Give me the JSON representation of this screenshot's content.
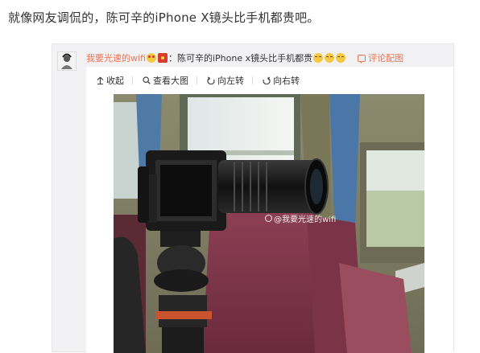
{
  "article": {
    "text": "就像网友调侃的，陈可辛的iPhone X镜头比手机都贵吧。"
  },
  "weibo_post": {
    "username": "我要光速的wifi",
    "separator": "：",
    "content": "陈可辛的iPhone  x镜头比手机都贵",
    "comment_link": "评论配图",
    "emojis": [
      "heart-eyes",
      "red-packet",
      "laugh",
      "laugh",
      "laugh"
    ]
  },
  "toolbar": {
    "collapse": "收起",
    "view_large": "查看大图",
    "rotate_left": "向左转",
    "rotate_right": "向右转"
  },
  "photo": {
    "watermark": "@我要光速的wifi"
  },
  "colors": {
    "username": "#eb7350",
    "card_background": "#f2f2f5",
    "text": "#333333"
  }
}
